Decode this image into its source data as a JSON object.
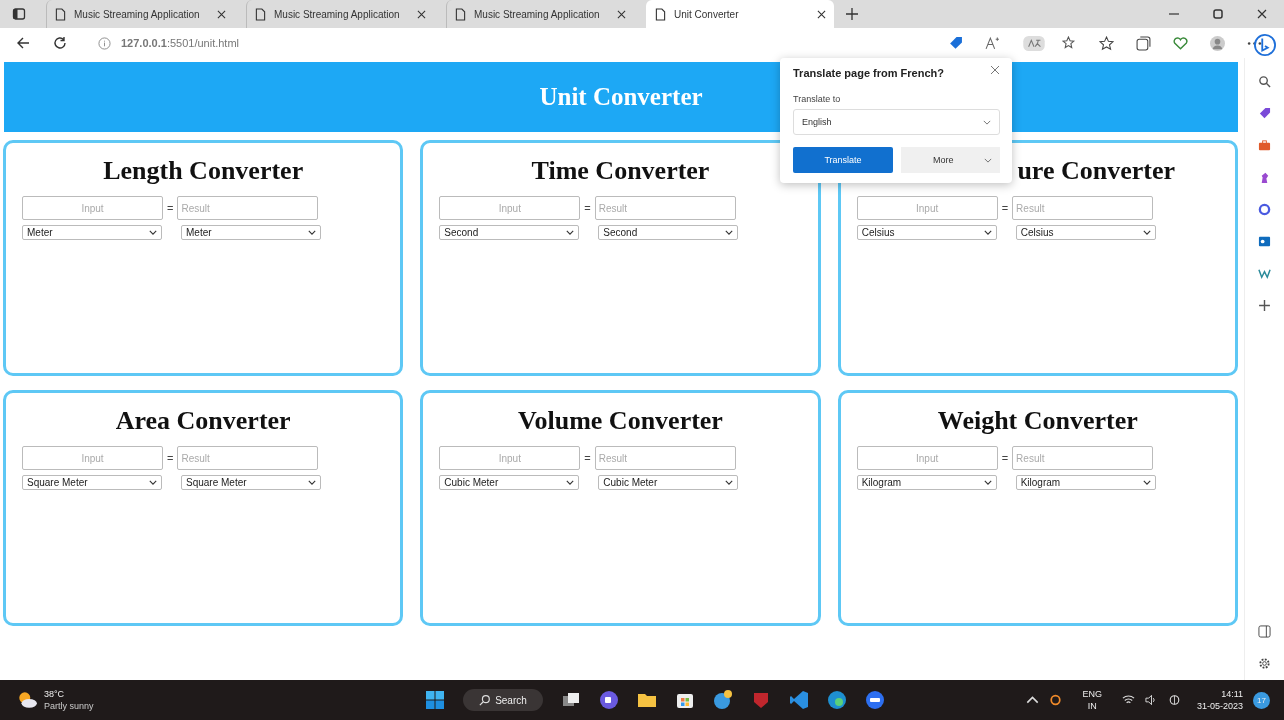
{
  "browser": {
    "tabs": [
      {
        "title": "Music Streaming Application",
        "selected": false
      },
      {
        "title": "Music Streaming Application",
        "selected": false
      },
      {
        "title": "Music Streaming Application",
        "selected": false
      },
      {
        "title": "Unit Converter",
        "selected": true
      }
    ],
    "address": "**127.0.0.1**:5501/unit.html"
  },
  "page": {
    "title": "Unit Converter",
    "converters": [
      {
        "title": "Length Converter",
        "equals": "=",
        "input_placeholder": "Input",
        "result_placeholder": "Result",
        "from_unit": "Meter",
        "to_unit": "Meter"
      },
      {
        "title": "Time Converter",
        "equals": "=",
        "input_placeholder": "Input",
        "result_placeholder": "Result",
        "from_unit": "Second",
        "to_unit": "Second"
      },
      {
        "title": "ure Converter",
        "equals": "=",
        "input_placeholder": "Input",
        "result_placeholder": "Result",
        "from_unit": "Celsius",
        "to_unit": "Celsius",
        "partly_covered": true
      },
      {
        "title": "Area Converter",
        "equals": "=",
        "input_placeholder": "Input",
        "result_placeholder": "Result",
        "from_unit": "Square Meter",
        "to_unit": "Square Meter"
      },
      {
        "title": "Volume Converter",
        "equals": "=",
        "input_placeholder": "Input",
        "result_placeholder": "Result",
        "from_unit": "Cubic Meter",
        "to_unit": "Cubic Meter"
      },
      {
        "title": "Weight Converter",
        "equals": "=",
        "input_placeholder": "Input",
        "result_placeholder": "Result",
        "from_unit": "Kilogram",
        "to_unit": "Kilogram"
      }
    ]
  },
  "translate_popup": {
    "title": "Translate page from French?",
    "label": "Translate to",
    "language": "English",
    "translate_button": "Translate",
    "more_button": "More"
  },
  "taskbar": {
    "temperature": "38°C",
    "weather": "Partly sunny",
    "search": "Search",
    "language": "ENG",
    "region": "IN",
    "time": "14:11",
    "date": "31-05-2023",
    "notifications": "17"
  }
}
